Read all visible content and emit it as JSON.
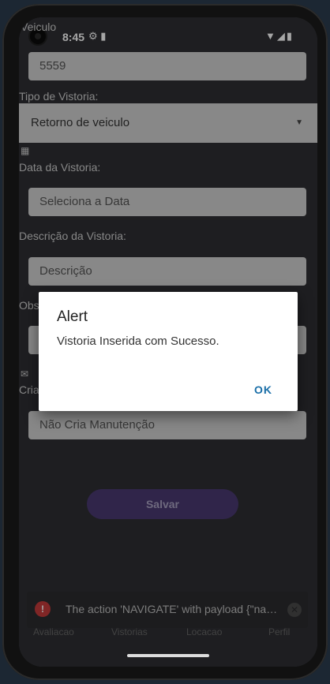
{
  "status_bar": {
    "time": "8:45",
    "left_icons": "⚙ ▮",
    "right_icons": "▼◢▮"
  },
  "form": {
    "veiculo_label": "Veiculo",
    "veiculo_value": "5559",
    "tipo_label": "Tipo de Vistoria:",
    "tipo_value": "Retorno de veiculo",
    "data_label": "Data da Vistoria:",
    "data_placeholder": "Seleciona a Data",
    "descricao_label": "Descrição da Vistoria:",
    "descricao_placeholder": "Descrição",
    "obs_label": "Obs",
    "cria_label": "Cria",
    "cria_value": "Não Cria Manutenção",
    "save_label": "Salvar"
  },
  "toast": {
    "text": "The action 'NAVIGATE' with payload {\"name..."
  },
  "tabs": [
    "Avaliacao",
    "Vistorias",
    "Locacao",
    "Perfil"
  ],
  "dialog": {
    "title": "Alert",
    "message": "Vistoria Inserida com Sucesso.",
    "ok_label": "OK"
  },
  "colors": {
    "accent": "#1a6fa8",
    "button": "#4a3a72",
    "error": "#c53b3b"
  }
}
